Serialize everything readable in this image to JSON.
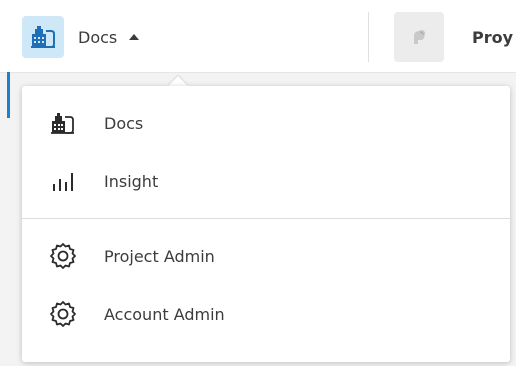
{
  "header": {
    "current_app": {
      "label": "Docs",
      "icon": "docs-building-icon",
      "tile_color": "#cfe8f8"
    },
    "project": {
      "label": "Proy",
      "icon": "project-hand-icon"
    }
  },
  "dropdown": {
    "sections": [
      {
        "items": [
          {
            "label": "Docs",
            "icon": "docs-building-icon"
          },
          {
            "label": "Insight",
            "icon": "insight-bars-icon"
          }
        ]
      },
      {
        "items": [
          {
            "label": "Project Admin",
            "icon": "gear-icon"
          },
          {
            "label": "Account Admin",
            "icon": "gear-icon"
          }
        ]
      }
    ]
  },
  "colors": {
    "accent": "#1f7ed0",
    "text": "#3c3c3c",
    "divider": "#dcdcdc"
  }
}
